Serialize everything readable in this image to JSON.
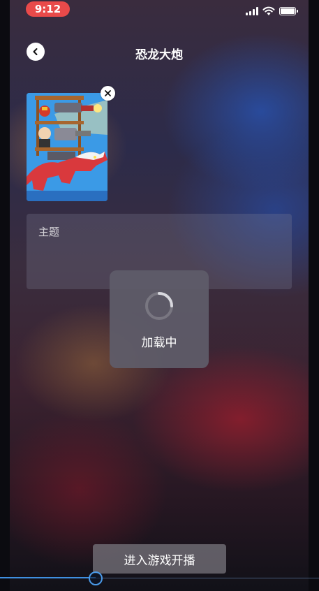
{
  "status_bar": {
    "time": "9:12",
    "icons": [
      "signal-icon",
      "wifi-icon",
      "battery-icon"
    ]
  },
  "header": {
    "back_icon": "chevron-left-icon",
    "title": "恐龙大炮"
  },
  "cover_image": {
    "description_icon": "game-cover-image",
    "remove_icon": "close-icon"
  },
  "topic_field": {
    "placeholder": "主题"
  },
  "loading_overlay": {
    "text": "加载中"
  },
  "footer": {
    "start_button_label": "进入游戏开播"
  },
  "playback_progress": {
    "fraction": 0.3
  },
  "colors": {
    "time_pill": "#e94a4a",
    "progress_accent": "#3f8fe0"
  }
}
